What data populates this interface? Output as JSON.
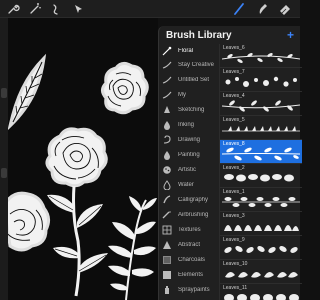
{
  "toolbar": {
    "left_tools": [
      "wrench-icon",
      "magic-wand-icon",
      "adjustments-icon",
      "select-arrow-icon"
    ],
    "right_tools": [
      "brush-icon",
      "smudge-icon",
      "eraser-icon"
    ],
    "active_tool": "brush-icon",
    "accent_color": "#3b82f6"
  },
  "panel": {
    "title": "Brush Library",
    "add_label": "+"
  },
  "brush_sets": [
    {
      "label": "Floral",
      "icon": "floral-brush-icon"
    },
    {
      "label": "Stay Creative",
      "icon": "brush-stroke-icon"
    },
    {
      "label": "Untitled Set",
      "icon": "brush-stroke-icon"
    },
    {
      "label": "My",
      "icon": "brush-stroke-icon"
    },
    {
      "label": "Sketching",
      "icon": "pencil-tip-icon"
    },
    {
      "label": "Inking",
      "icon": "ink-drop-icon"
    },
    {
      "label": "Drawing",
      "icon": "swirl-icon"
    },
    {
      "label": "Painting",
      "icon": "paint-drop-icon"
    },
    {
      "label": "Artistic",
      "icon": "palette-icon"
    },
    {
      "label": "Water",
      "icon": "water-drop-icon"
    },
    {
      "label": "Calligraphy",
      "icon": "calligraphy-icon"
    },
    {
      "label": "Airbrushing",
      "icon": "airbrush-icon"
    },
    {
      "label": "Textures",
      "icon": "texture-grid-icon"
    },
    {
      "label": "Abstract",
      "icon": "abstract-triangle-icon"
    },
    {
      "label": "Charcoals",
      "icon": "charcoal-icon"
    },
    {
      "label": "Elements",
      "icon": "elements-icon"
    },
    {
      "label": "Spraypaints",
      "icon": "spray-can-icon"
    }
  ],
  "brushes": [
    {
      "name": "Leaves_6"
    },
    {
      "name": "Leaves_7"
    },
    {
      "name": "Leaves_4"
    },
    {
      "name": "Leaves_5"
    },
    {
      "name": "Leaves_8"
    },
    {
      "name": "Leaves_2"
    },
    {
      "name": "Leaves_1"
    },
    {
      "name": "Leaves_3"
    },
    {
      "name": "Leaves_9"
    },
    {
      "name": "Leaves_10"
    },
    {
      "name": "Leaves_11"
    }
  ],
  "selected_brush": "Leaves_8",
  "selected_color": "#1e6fe0"
}
